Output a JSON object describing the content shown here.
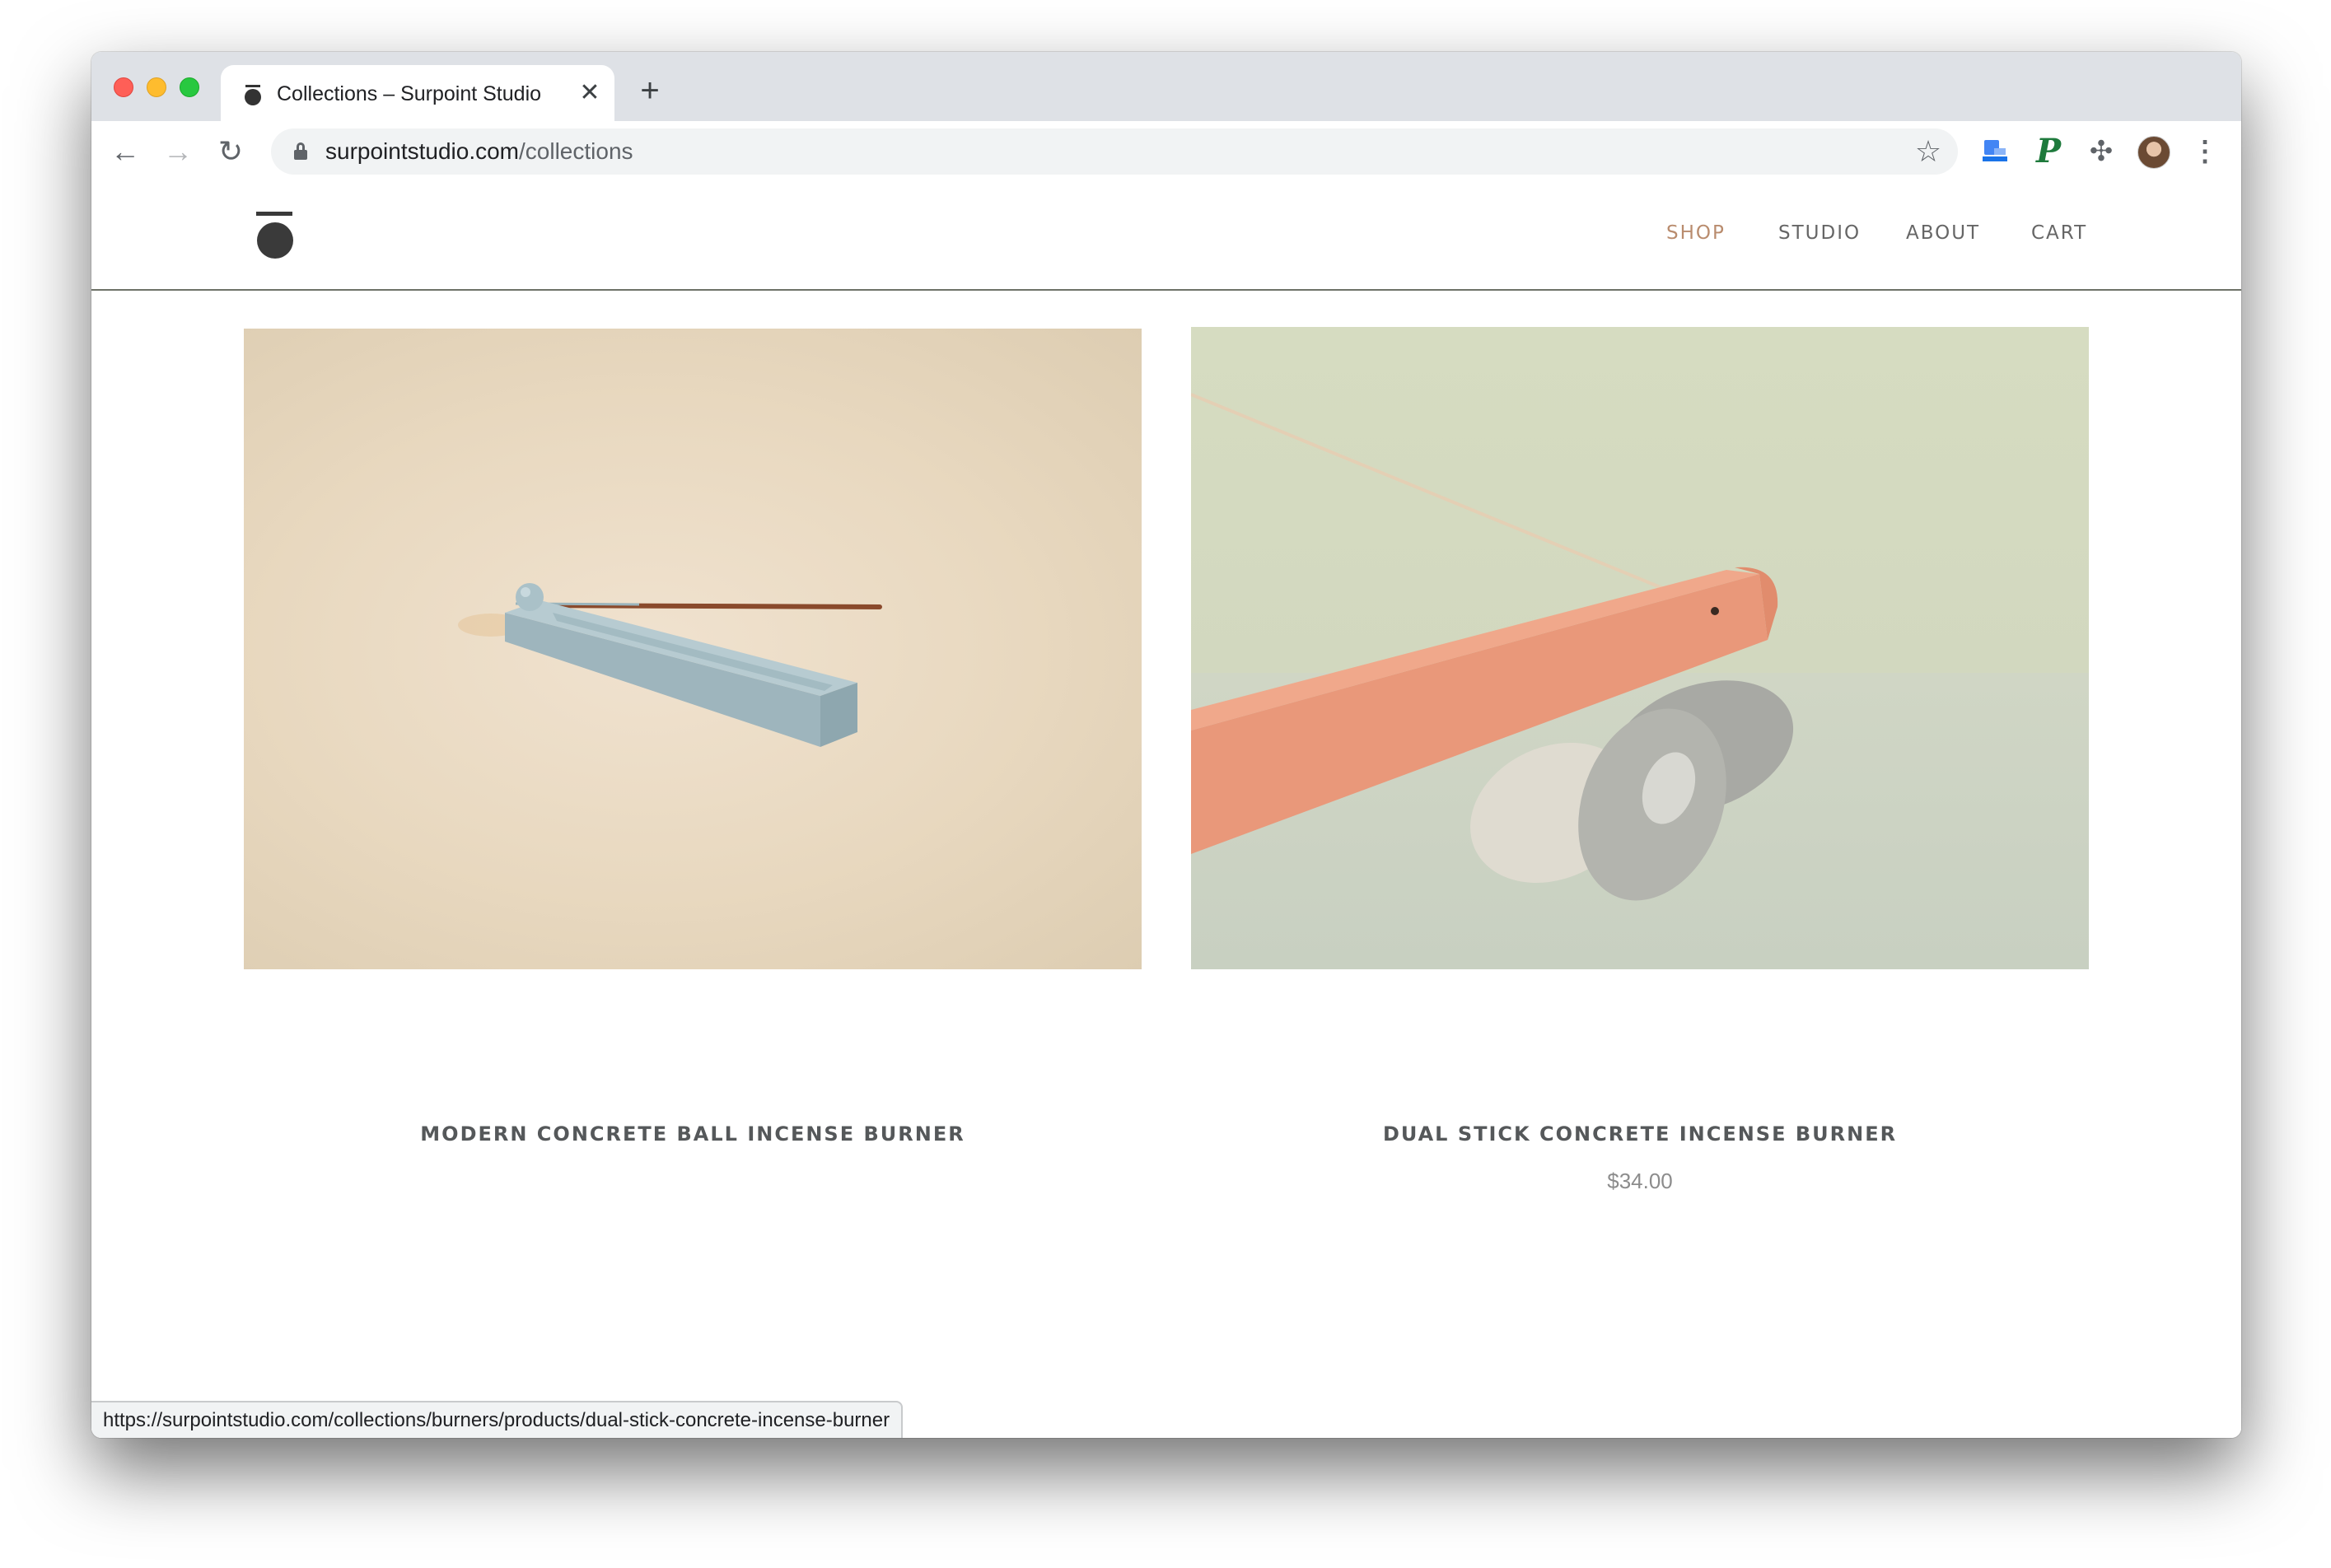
{
  "browser": {
    "tab": {
      "title": "Collections – Surpoint Studio",
      "close_glyph": "✕",
      "favicon": "surpoint-logo-icon"
    },
    "new_tab_glyph": "+",
    "toolbar": {
      "back_glyph": "←",
      "forward_glyph": "→",
      "reload_glyph": "↻",
      "star_glyph": "☆",
      "menu_glyph": "⋮",
      "extensions": [
        {
          "name": "bookmark-manager-extension-icon"
        },
        {
          "name": "p-extension-icon",
          "glyph": "P"
        },
        {
          "name": "puzzle-extension-icon",
          "glyph": "✣"
        }
      ]
    },
    "omnibox": {
      "url_host": "surpointstudio.com",
      "url_path": "/collections"
    },
    "status_url": "https://surpointstudio.com/collections/burners/products/dual-stick-concrete-incense-burner"
  },
  "site": {
    "nav": [
      {
        "label": "SHOP",
        "active": true
      },
      {
        "label": "STUDIO",
        "active": false
      },
      {
        "label": "ABOUT",
        "active": false
      },
      {
        "label": "CART",
        "active": false
      }
    ],
    "accent_color": "#b98c6e",
    "products": [
      {
        "name": "MODERN CONCRETE BALL INCENSE BURNER",
        "price": "",
        "image": "light-blue-concrete-ball-incense-burner-on-beige"
      },
      {
        "name": "DUAL STICK CONCRETE INCENSE BURNER",
        "price": "$34.00",
        "image": "coral-dual-stick-incense-burner-on-stones"
      }
    ]
  }
}
